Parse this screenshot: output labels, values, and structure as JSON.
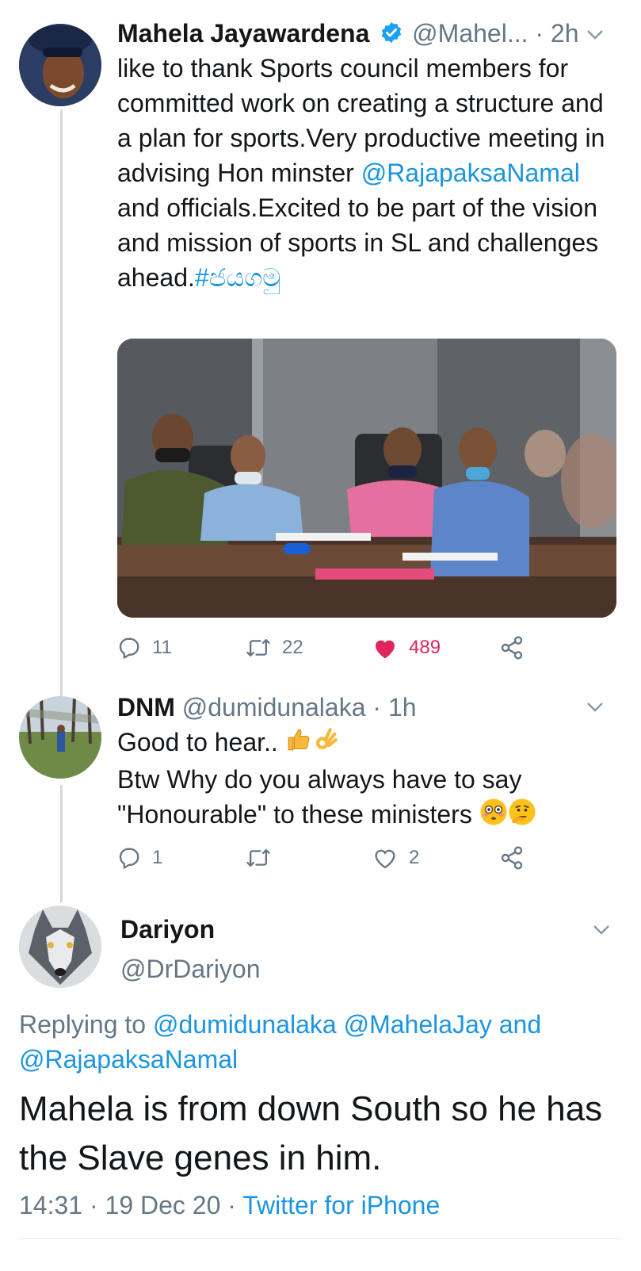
{
  "tweet1": {
    "name": "Mahela Jayawardena",
    "handle": "@Mahel...",
    "time": "· 2h",
    "text_before_mention": "like to thank Sports council members for committed work on creating a structure and a plan for sports.Very productive meeting in advising Hon minster ",
    "mention": "@RajapaksaNamal",
    "text_after_mention": " and officials.Excited to be part of the vision and mission of sports in SL and challenges ahead.",
    "hashtag": "#ජයගමු",
    "replies": "11",
    "retweets": "22",
    "likes": "489",
    "like_color": "#e0245e"
  },
  "tweet2": {
    "name": "DNM",
    "handle": "@dumidunalaka",
    "time": "· 1h",
    "line1": "Good to hear..",
    "line2": "Btw Why do you always have to say",
    "line3": "\"Honourable\" to these ministers",
    "replies": "1",
    "likes": "2"
  },
  "tweet3": {
    "name": "Dariyon",
    "handle": "@DrDariyon",
    "replying_to_prefix": "Replying to",
    "replying_mention1": "@dumidunalaka",
    "replying_mention2": "@MahelaJay",
    "replying_and": "and",
    "replying_mention3": "@RajapaksaNamal",
    "text": "Mahela is from down South so he has the Slave genes in him.",
    "time": "14:31",
    "date": "19 Dec 20",
    "source": "Twitter for iPhone"
  },
  "colors": {
    "link": "#1b95e0",
    "verified": "#1da1f2",
    "muted": "#657786"
  },
  "icons": [
    "verified-badge-icon",
    "chevron-down-icon",
    "reply-icon",
    "retweet-icon",
    "like-icon",
    "share-icon"
  ]
}
